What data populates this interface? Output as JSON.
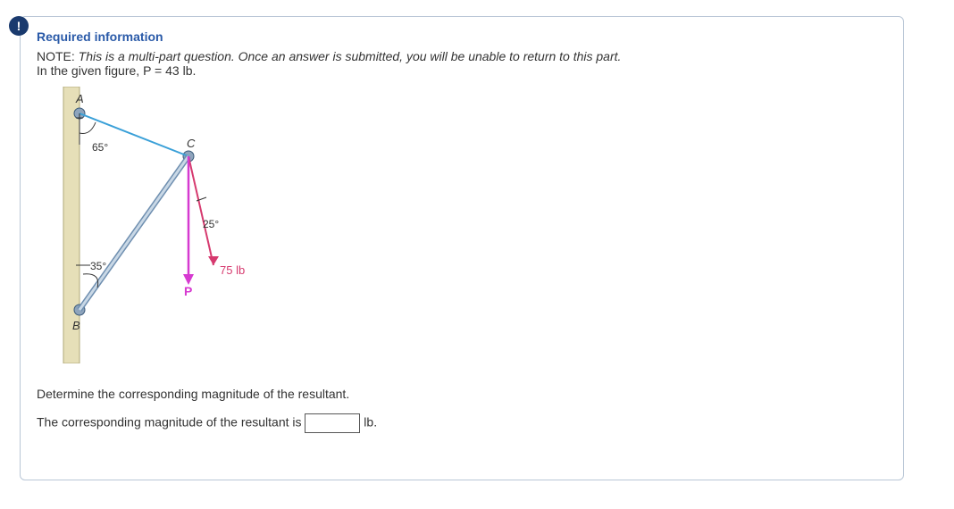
{
  "badge": "!",
  "header": {
    "title": "Required information",
    "note_label": "NOTE:",
    "note_text": "This is a multi-part question. Once an answer is submitted, you will be unable to return to this part.",
    "given": "In the given figure, P = 43 lb."
  },
  "figure": {
    "labels": {
      "A": "A",
      "B": "B",
      "C": "C",
      "P": "P",
      "angle_A": "65°",
      "angle_B": "35°",
      "angle_C": "25°",
      "force75": "75 lb"
    }
  },
  "question": {
    "prompt": "Determine the corresponding magnitude of the resultant.",
    "answer_lead": "The corresponding magnitude of the resultant is",
    "unit": "lb."
  }
}
